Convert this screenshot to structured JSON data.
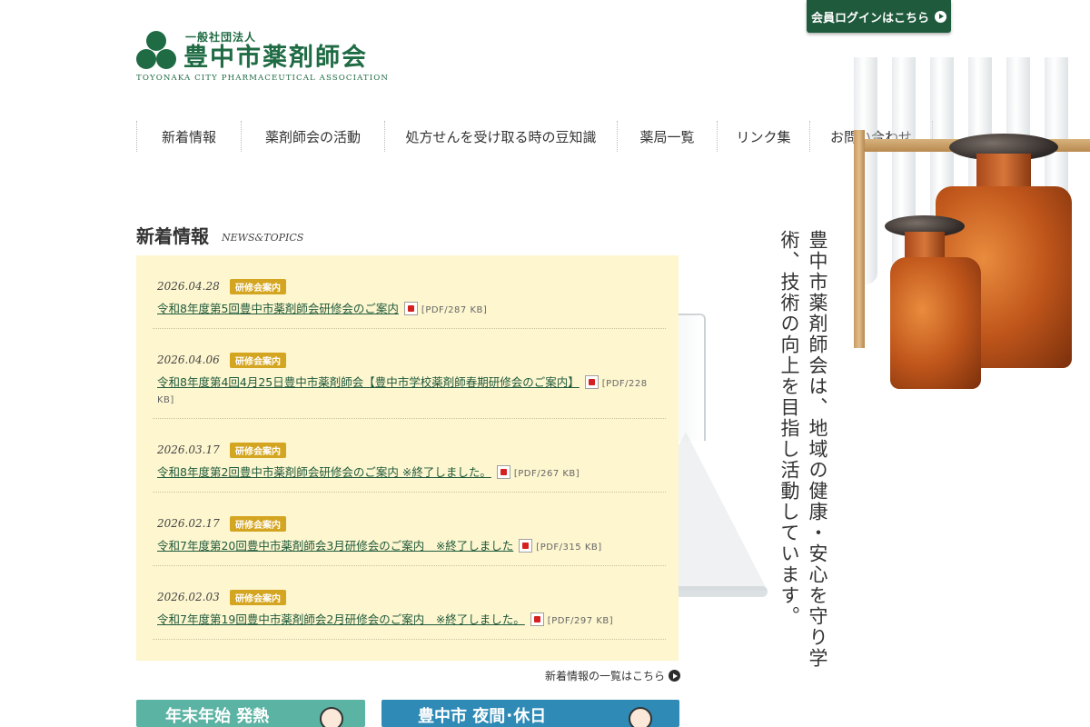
{
  "header": {
    "logo_mark": "トヨナカ",
    "org_type": "一般社団法人",
    "org_name": "豊中市薬剤師会",
    "org_name_en": "TOYONAKA CITY PHARMACEUTICAL ASSOCIATION",
    "login_label": "会員ログインはこちら"
  },
  "nav": {
    "items": [
      {
        "label": "新着情報",
        "width": 115
      },
      {
        "label": "薬剤師会の活動",
        "width": 158
      },
      {
        "label": "処方せんを受け取る時の豆知識",
        "width": 256
      },
      {
        "label": "薬局一覧",
        "width": 110
      },
      {
        "label": "リンク集",
        "width": 102
      },
      {
        "label": "お問い合わせ",
        "width": 136
      }
    ]
  },
  "hero": {
    "tagline": "豊中市薬剤師会は、地域の健康・安心を守り学術、技術の向上を目指し活動しています。"
  },
  "news": {
    "title": "新着情報",
    "subtitle": "NEWS&TOPICS",
    "more_label": "新着情報の一覧はこちら",
    "items": [
      {
        "date": "2026.04.28",
        "badge": "研修会案内",
        "title": "令和8年度第5回豊中市薬剤師会研修会のご案内",
        "size": "[PDF/287 KB]"
      },
      {
        "date": "2026.04.06",
        "badge": "研修会案内",
        "title": "令和8年度第4回4月25日豊中市薬剤師会【豊中市学校薬剤師春期研修会のご案内】",
        "size": "[PDF/228 KB]"
      },
      {
        "date": "2026.03.17",
        "badge": "研修会案内",
        "title": "令和8年度第2回豊中市薬剤師会研修会のご案内 ※終了しました。",
        "size": "[PDF/267 KB]"
      },
      {
        "date": "2026.02.17",
        "badge": "研修会案内",
        "title": "令和7年度第20回豊中市薬剤師会3月研修会のご案内　※終了しました",
        "size": "[PDF/315 KB]"
      },
      {
        "date": "2026.02.03",
        "badge": "研修会案内",
        "title": "令和7年度第19回豊中市薬剤師会2月研修会のご案内　※終了しました。",
        "size": "[PDF/297 KB]"
      }
    ]
  },
  "banners": {
    "left_label": "年末年始 発熱",
    "right_label": "豊中市 夜間･休日"
  },
  "colors": {
    "brand_green": "#1f6b44",
    "news_background": "#fdf6cf",
    "badge": "#d4a520"
  }
}
